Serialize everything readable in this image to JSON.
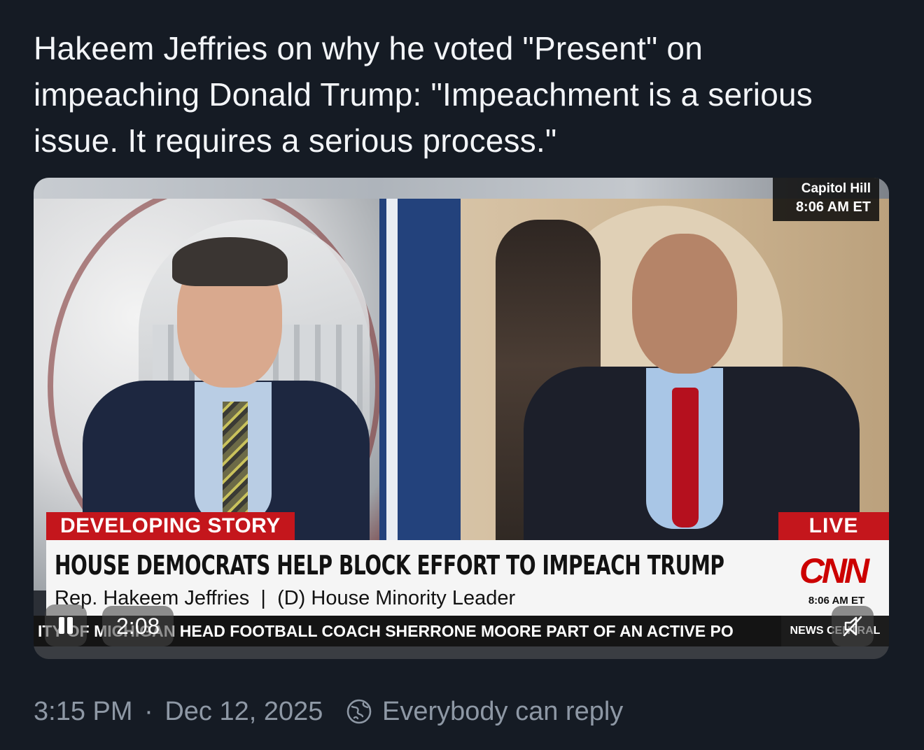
{
  "post": {
    "text": "Hakeem Jeffries on why he voted \"Present\" on impeaching Donald Trump: \"Impeachment is a serious issue. It requires a serious process.\""
  },
  "video": {
    "corner_tag": {
      "location": "Capitol Hill",
      "time": "8:06 AM ET"
    },
    "developing_label": "DEVELOPING STORY",
    "live_label": "LIVE",
    "headline": "HOUSE DEMOCRATS HELP BLOCK EFFORT TO IMPEACH TRUMP",
    "subline": "Rep. Hakeem Jeffries  |  (D) House Minority Leader",
    "network_logo": "CNN",
    "network_time": "8:06 AM ET",
    "ticker": "ITY OF MICHIGAN HEAD FOOTBALL COACH SHERRONE MOORE PART OF AN ACTIVE PO",
    "ticker_brand": "NEWS CENTRAL",
    "controls": {
      "pause_icon": "pause-icon",
      "elapsed": "2:08",
      "mute_icon": "muted-speaker-icon"
    }
  },
  "footer": {
    "time": "3:15 PM",
    "separator": "·",
    "date": "Dec 12, 2025",
    "reply_icon": "globe-reply-icon",
    "reply_setting": "Everybody can reply"
  }
}
